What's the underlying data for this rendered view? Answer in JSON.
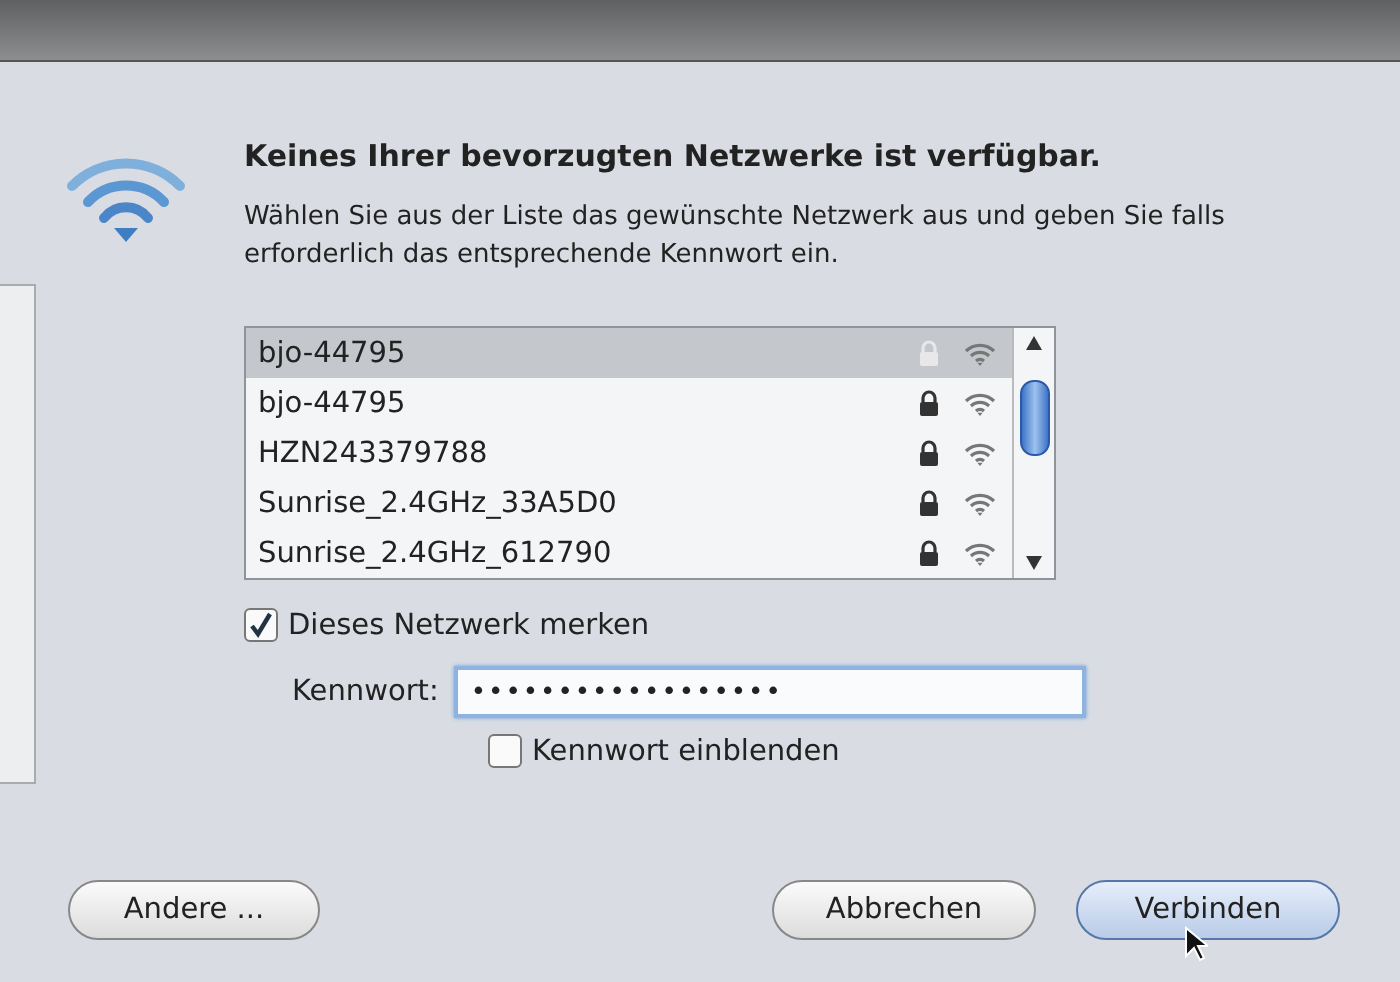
{
  "dialog": {
    "title": "Keines Ihrer bevorzugten Netzwerke ist verfügbar.",
    "message": "Wählen Sie aus der Liste das gewünschte Netzwerk aus und geben Sie falls erforderlich das entsprechende Kennwort ein."
  },
  "networks": [
    {
      "name": "bjo-44795",
      "locked": true,
      "selected": true
    },
    {
      "name": "bjo-44795",
      "locked": true,
      "selected": false
    },
    {
      "name": "HZN243379788",
      "locked": true,
      "selected": false
    },
    {
      "name": "Sunrise_2.4GHz_33A5D0",
      "locked": true,
      "selected": false
    },
    {
      "name": "Sunrise_2.4GHz_612790",
      "locked": true,
      "selected": false
    }
  ],
  "remember": {
    "label": "Dieses Netzwerk merken",
    "checked": true
  },
  "password": {
    "label": "Kennwort:",
    "value": "••••••••••••••••••"
  },
  "show_password": {
    "label": "Kennwort einblenden",
    "checked": false
  },
  "buttons": {
    "other": "Andere ...",
    "cancel": "Abbrechen",
    "connect": "Verbinden"
  }
}
